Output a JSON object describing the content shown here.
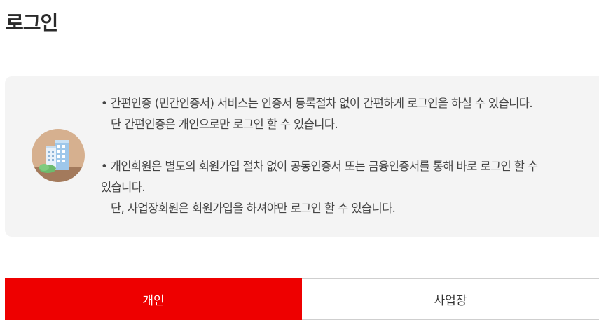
{
  "page": {
    "title": "로그인"
  },
  "notice": {
    "icon": "office-building-icon",
    "paragraphs": [
      {
        "lines": [
          "• 간편인증 (민간인증서) 서비스는 인증서 등록절차 없이 간편하게 로그인을 하실 수 있습니다.",
          "단 간편인증은 개인으로만 로그인 할 수 있습니다."
        ]
      },
      {
        "lines": [
          "• 개인회원은 별도의 회원가입 절차 없이 공동인증서 또는 금융인증서를 통해 바로 로그인 할 수",
          "있습니다.",
          "단, 사업장회원은 회원가입을 하셔야만 로그인 할 수 있습니다."
        ]
      }
    ]
  },
  "tabs": [
    {
      "label": "개인",
      "active": true
    },
    {
      "label": "사업장",
      "active": false
    }
  ],
  "colors": {
    "accent": "#ee0000",
    "notice_bg": "#f4f4f4",
    "icon_circle": "#d6b08f"
  }
}
